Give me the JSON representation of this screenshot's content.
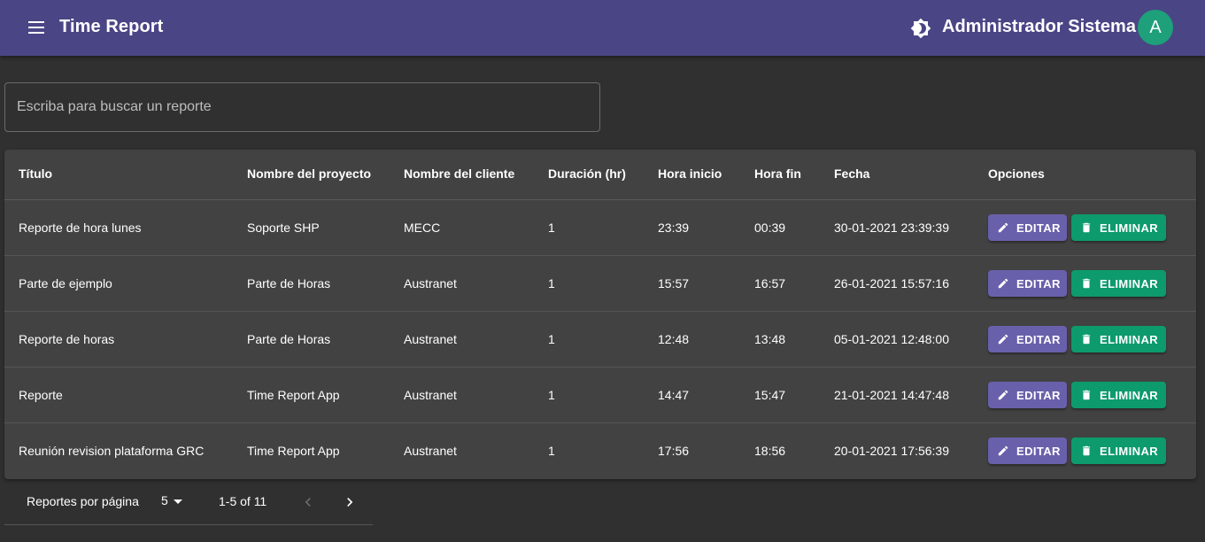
{
  "appbar": {
    "title": "Time Report",
    "user_name": "Administrador Sistema",
    "avatar_initial": "A",
    "menu_icon": "menu-icon",
    "theme_icon": "brightness-icon",
    "bg_color": "#4a4585"
  },
  "search": {
    "placeholder": "Escriba para buscar un reporte",
    "value": ""
  },
  "table": {
    "headers": [
      "Título",
      "Nombre del proyecto",
      "Nombre del cliente",
      "Duración (hr)",
      "Hora inicio",
      "Hora fin",
      "Fecha",
      "Opciones"
    ],
    "rows": [
      {
        "titulo": "Reporte de hora lunes",
        "proyecto": "Soporte SHP",
        "cliente": "MECC",
        "duracion": "1",
        "inicio": "23:39",
        "fin": "00:39",
        "fecha": "30-01-2021 23:39:39"
      },
      {
        "titulo": "Parte de ejemplo",
        "proyecto": "Parte de Horas",
        "cliente": "Austranet",
        "duracion": "1",
        "inicio": "15:57",
        "fin": "16:57",
        "fecha": "26-01-2021 15:57:16"
      },
      {
        "titulo": "Reporte de horas",
        "proyecto": "Parte de Horas",
        "cliente": "Austranet",
        "duracion": "1",
        "inicio": "12:48",
        "fin": "13:48",
        "fecha": "05-01-2021 12:48:00"
      },
      {
        "titulo": "Reporte",
        "proyecto": "Time Report App",
        "cliente": "Austranet",
        "duracion": "1",
        "inicio": "14:47",
        "fin": "15:47",
        "fecha": "21-01-2021 14:47:48"
      },
      {
        "titulo": "Reunión revision plataforma GRC",
        "proyecto": "Time Report App",
        "cliente": "Austranet",
        "duracion": "1",
        "inicio": "17:56",
        "fin": "18:56",
        "fecha": "20-01-2021 17:56:39"
      }
    ],
    "edit_label": "EDITAR",
    "delete_label": "ELIMINAR",
    "edit_color": "#6960ab",
    "delete_color": "#0d9a6c"
  },
  "pagination": {
    "rows_per_page_label": "Reportes por página",
    "rows_per_page_value": "5",
    "range": "1-5 of 11",
    "prev_icon": "chevron-left-icon",
    "next_icon": "chevron-right-icon"
  }
}
